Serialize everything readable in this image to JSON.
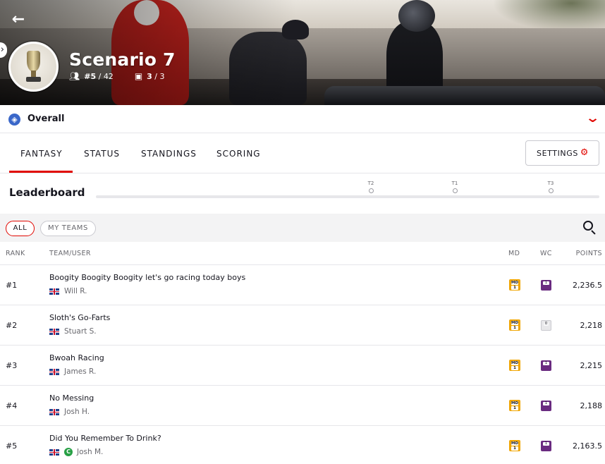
{
  "hero": {
    "title": "Scenario 7",
    "rank": "#5",
    "total_entries": "42",
    "teams_used": "3",
    "teams_total": "3"
  },
  "overall": {
    "label": "Overall"
  },
  "tabs": [
    {
      "label": "FANTASY",
      "active": true
    },
    {
      "label": "STATUS",
      "active": false
    },
    {
      "label": "STANDINGS",
      "active": false
    },
    {
      "label": "SCORING",
      "active": false
    }
  ],
  "settings": {
    "label": "SETTINGS"
  },
  "leaderboard": {
    "title": "Leaderboard",
    "markers": [
      "T2",
      "T1",
      "T3"
    ]
  },
  "filters": {
    "all": "ALL",
    "my_teams": "MY TEAMS"
  },
  "table": {
    "headers": {
      "rank": "RANK",
      "team": "TEAM/USER",
      "md": "MD",
      "wc": "WC",
      "points": "POINTS"
    },
    "rows": [
      {
        "rank": "#1",
        "team": "Boogity Boogity Boogity let's go racing today boys",
        "user": "Will R.",
        "md": "1",
        "wc": "1",
        "wc_used": true,
        "points": "2,236.5",
        "badge": ""
      },
      {
        "rank": "#2",
        "team": "Sloth's Go-Farts",
        "user": "Stuart S.",
        "md": "1",
        "wc": "0",
        "wc_used": false,
        "points": "2,218",
        "badge": ""
      },
      {
        "rank": "#3",
        "team": "Bwoah Racing",
        "user": "James R.",
        "md": "1",
        "wc": "1",
        "wc_used": true,
        "points": "2,215",
        "badge": ""
      },
      {
        "rank": "#4",
        "team": "No Messing",
        "user": "Josh H.",
        "md": "1",
        "wc": "1",
        "wc_used": true,
        "points": "2,188",
        "badge": ""
      },
      {
        "rank": "#5",
        "team": "Did You Remember To Drink?",
        "user": "Josh M.",
        "md": "1",
        "wc": "1",
        "wc_used": true,
        "points": "2,163.5",
        "badge": "C"
      }
    ]
  },
  "chip_labels": {
    "md": "MD"
  },
  "colors": {
    "accent": "#e10600",
    "md_chip": "#f0a500",
    "wc_chip": "#6a2b80"
  }
}
